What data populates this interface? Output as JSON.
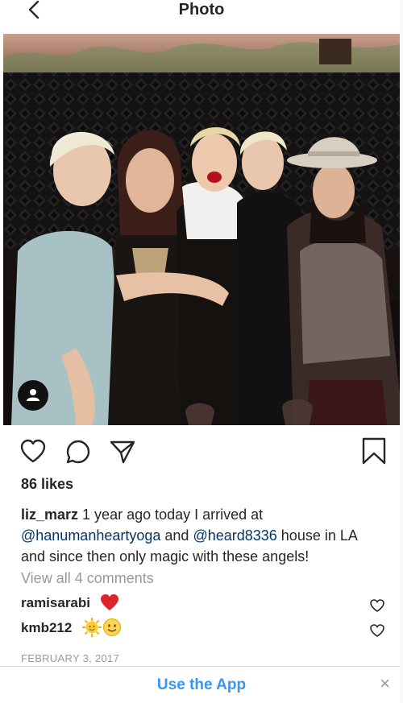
{
  "header": {
    "title": "Photo",
    "back_icon": "chevron-left-icon"
  },
  "post": {
    "likes": "86 likes",
    "caption": {
      "username": "liz_marz",
      "text_1": " 1 year ago today I arrived at ",
      "mention_1": "@hanumanheartyoga",
      "text_2": " and ",
      "mention_2": "@heard8336",
      "text_3": " house in LA and since then only magic with these angels!"
    },
    "view_comments": "View all 4 comments",
    "comments": [
      {
        "username": "ramisarabi",
        "emoji": "red-heart"
      },
      {
        "username": "kmb212",
        "emoji": "sun-with-face, smiling-face"
      }
    ],
    "date": "FEBRUARY 3, 2017"
  },
  "icons": {
    "like": "heart-icon",
    "comment": "comment-bubble-icon",
    "share": "paper-plane-icon",
    "save": "bookmark-icon",
    "user_tag": "person-icon"
  },
  "footer": {
    "use_app": "Use the App",
    "close": "×"
  },
  "colors": {
    "link": "#003569",
    "accent": "#3897f0",
    "muted": "#999999",
    "text": "#262626",
    "heart_red": "#e0242c"
  }
}
